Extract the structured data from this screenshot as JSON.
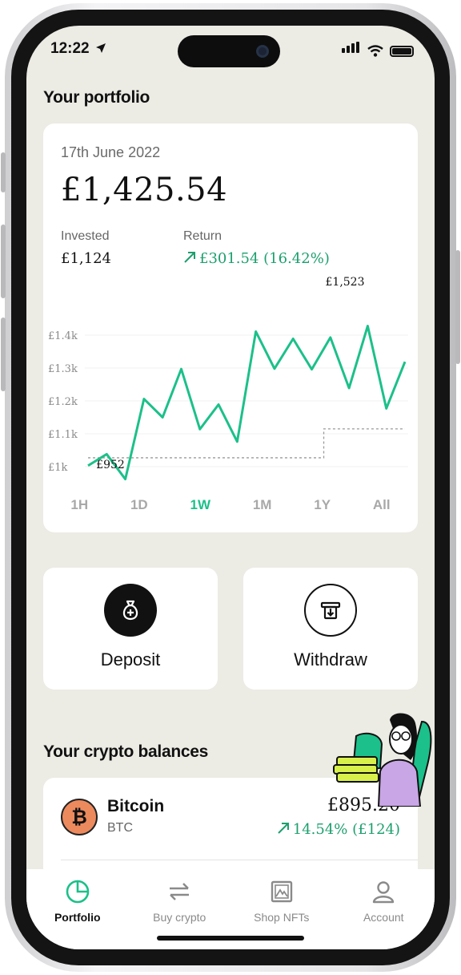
{
  "status": {
    "time": "12:22"
  },
  "portfolio": {
    "title": "Your portfolio",
    "date": "17th June 2022",
    "total": "£1,425.54",
    "invested_label": "Invested",
    "invested_value": "£1,124",
    "return_label": "Return",
    "return_value": "£301.54 (16.42%)",
    "chart_high_label": "£1,523",
    "chart_low_label": "£952",
    "y_ticks": [
      "£1.4k",
      "£1.3k",
      "£1.2k",
      "£1.1k",
      "£1k"
    ],
    "timeframes": [
      "1H",
      "1D",
      "1W",
      "1M",
      "1Y",
      "All"
    ],
    "active_timeframe": "1W"
  },
  "chart_data": {
    "type": "line",
    "y_ticks": [
      "£1.4k",
      "£1.3k",
      "£1.2k",
      "£1.1k",
      "£1k"
    ],
    "ylim": [
      1000,
      1400
    ],
    "series": [
      {
        "values": [
          1003,
          1038,
          962,
          1206,
          1150,
          1297,
          1114,
          1189,
          1076,
          1411,
          1298,
          1389,
          1296,
          1393,
          1239,
          1428,
          1177,
          1319
        ]
      }
    ],
    "reference_line": {
      "values": [
        1027,
        1027,
        1027,
        1027,
        1027,
        1115,
        1115,
        1115
      ]
    },
    "annotations": [
      "£1,523",
      "£952"
    ],
    "colors": {
      "line": "#1cc08a",
      "reference": "#9a9a9a"
    }
  },
  "actions": {
    "deposit_label": "Deposit",
    "withdraw_label": "Withdraw"
  },
  "balances": {
    "title": "Your crypto balances",
    "items": [
      {
        "name": "Bitcoin",
        "symbol": "BTC",
        "value": "£895.20",
        "change": "14.54% (£124)"
      }
    ]
  },
  "tabs": [
    {
      "label": "Portfolio",
      "icon": "pie-chart-icon"
    },
    {
      "label": "Buy crypto",
      "icon": "swap-arrows-icon"
    },
    {
      "label": "Shop NFTs",
      "icon": "picture-icon"
    },
    {
      "label": "Account",
      "icon": "user-icon"
    }
  ],
  "colors": {
    "accent": "#1cc08a",
    "background": "#ecebe4",
    "bitcoin": "#ec8a5e"
  }
}
